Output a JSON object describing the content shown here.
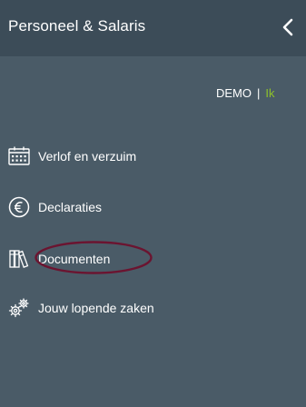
{
  "header": {
    "title": "Personeel & Salaris",
    "collapse_icon": "chevron-left-icon"
  },
  "user": {
    "company": "DEMO",
    "separator": "|",
    "me": "Ik",
    "me_color": "#8ec22a"
  },
  "menu": {
    "items": [
      {
        "label": "Verlof en verzuim",
        "icon": "calendar-icon"
      },
      {
        "label": "Declaraties",
        "icon": "euro-icon"
      },
      {
        "label": "Documenten",
        "icon": "books-icon",
        "highlighted": true
      },
      {
        "label": "Jouw lopende zaken",
        "icon": "gears-icon"
      }
    ]
  },
  "colors": {
    "panel_background": "#4a5b67",
    "header_background": "#3c4c58",
    "highlight_ellipse": "#6b1430"
  }
}
